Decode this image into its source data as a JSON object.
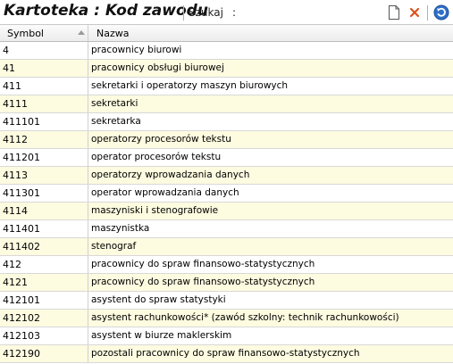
{
  "window": {
    "title": "Kartoteka : Kod zawodu",
    "search_label": "Szukaj",
    "search_colon": ":",
    "search_value": ""
  },
  "toolbar": {
    "icons": [
      "new-document-icon",
      "delete-x-icon",
      "refresh-icon"
    ],
    "delete_color": "#d9531e",
    "refresh_color": "#2f6fc9"
  },
  "table": {
    "columns": [
      "Symbol",
      "Nazwa"
    ],
    "sort_column": "Symbol",
    "rows": [
      {
        "symbol": "4",
        "name": "pracownicy biurowi"
      },
      {
        "symbol": "41",
        "name": "pracownicy obsługi biurowej"
      },
      {
        "symbol": "411",
        "name": "sekretarki i operatorzy maszyn biurowych"
      },
      {
        "symbol": "4111",
        "name": "sekretarki"
      },
      {
        "symbol": "411101",
        "name": "sekretarka"
      },
      {
        "symbol": "4112",
        "name": "operatorzy procesorów tekstu"
      },
      {
        "symbol": "411201",
        "name": "operator procesorów tekstu"
      },
      {
        "symbol": "4113",
        "name": "operatorzy wprowadzania danych"
      },
      {
        "symbol": "411301",
        "name": "operator wprowadzania danych"
      },
      {
        "symbol": "4114",
        "name": "maszyniski i stenografowie"
      },
      {
        "symbol": "411401",
        "name": "maszynistka"
      },
      {
        "symbol": "411402",
        "name": "stenograf"
      },
      {
        "symbol": "412",
        "name": "pracownicy do spraw finansowo-statystycznych"
      },
      {
        "symbol": "4121",
        "name": "pracownicy do spraw finansowo-statystycznych"
      },
      {
        "symbol": "412101",
        "name": "asystent do spraw statystyki"
      },
      {
        "symbol": "412102",
        "name": "asystent rachunkowości* (zawód szkolny: technik rachunkowości)"
      },
      {
        "symbol": "412103",
        "name": "asystent w biurze maklerskim"
      },
      {
        "symbol": "412190",
        "name": "pozostali pracownicy do spraw finansowo-statystycznych"
      }
    ]
  }
}
